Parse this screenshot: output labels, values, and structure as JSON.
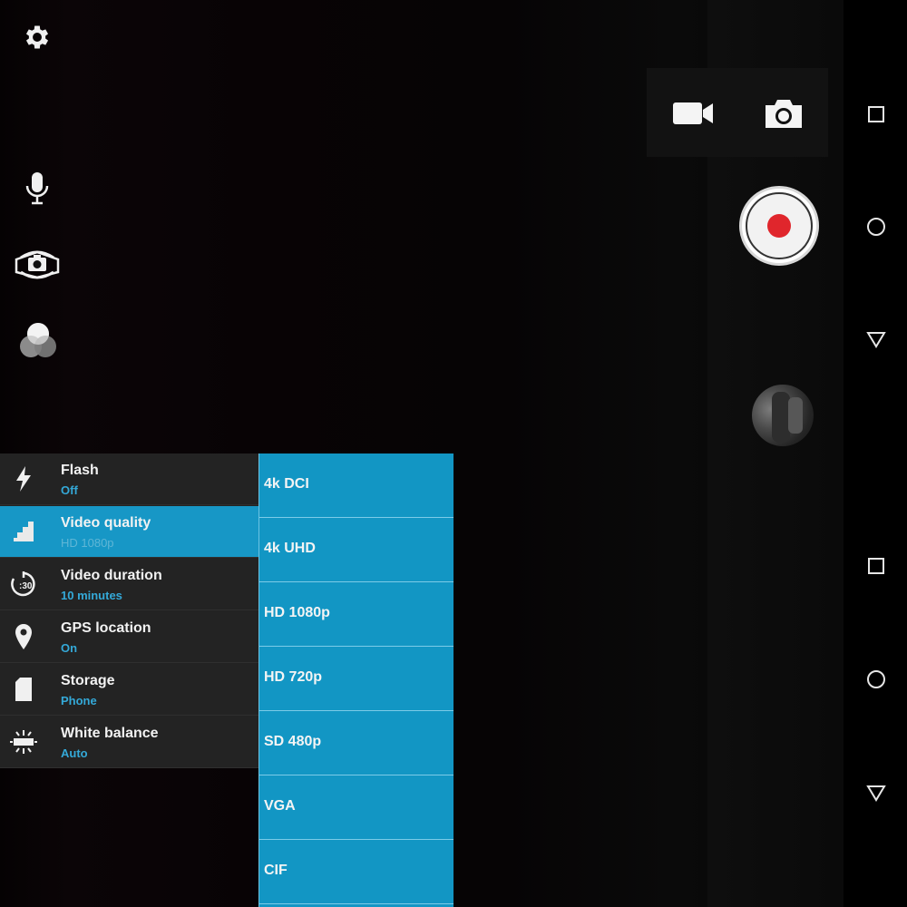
{
  "colors": {
    "accent": "#1797c6",
    "record_dot": "#e0262c",
    "value_text": "#34a9d8"
  },
  "left_toolbar": {
    "icons": [
      "gear-icon",
      "microphone-icon",
      "switch-camera-icon",
      "color-filter-icon"
    ]
  },
  "mode_switcher": {
    "icons": [
      "video-camera-icon",
      "photo-camera-icon"
    ]
  },
  "settings": [
    {
      "title": "Flash",
      "value": "Off",
      "icon": "flash-icon"
    },
    {
      "title": "Video quality",
      "value": "HD 1080p",
      "icon": "video-quality-icon",
      "selected": true
    },
    {
      "title": "Video duration",
      "value": "10 minutes",
      "icon": "timer-icon"
    },
    {
      "title": "GPS location",
      "value": "On",
      "icon": "location-pin-icon"
    },
    {
      "title": "Storage",
      "value": "Phone",
      "icon": "sd-card-icon"
    },
    {
      "title": "White balance",
      "value": "Auto",
      "icon": "white-balance-icon"
    }
  ],
  "video_quality_options": [
    "4k DCI",
    "4k UHD",
    "HD 1080p",
    "HD 720p",
    "SD 480p",
    "VGA",
    "CIF"
  ],
  "timer_icon_text": ":30",
  "nav_bar": {
    "icons": [
      "recents-icon",
      "home-icon",
      "back-icon",
      "recents-icon",
      "home-icon",
      "back-icon"
    ]
  }
}
